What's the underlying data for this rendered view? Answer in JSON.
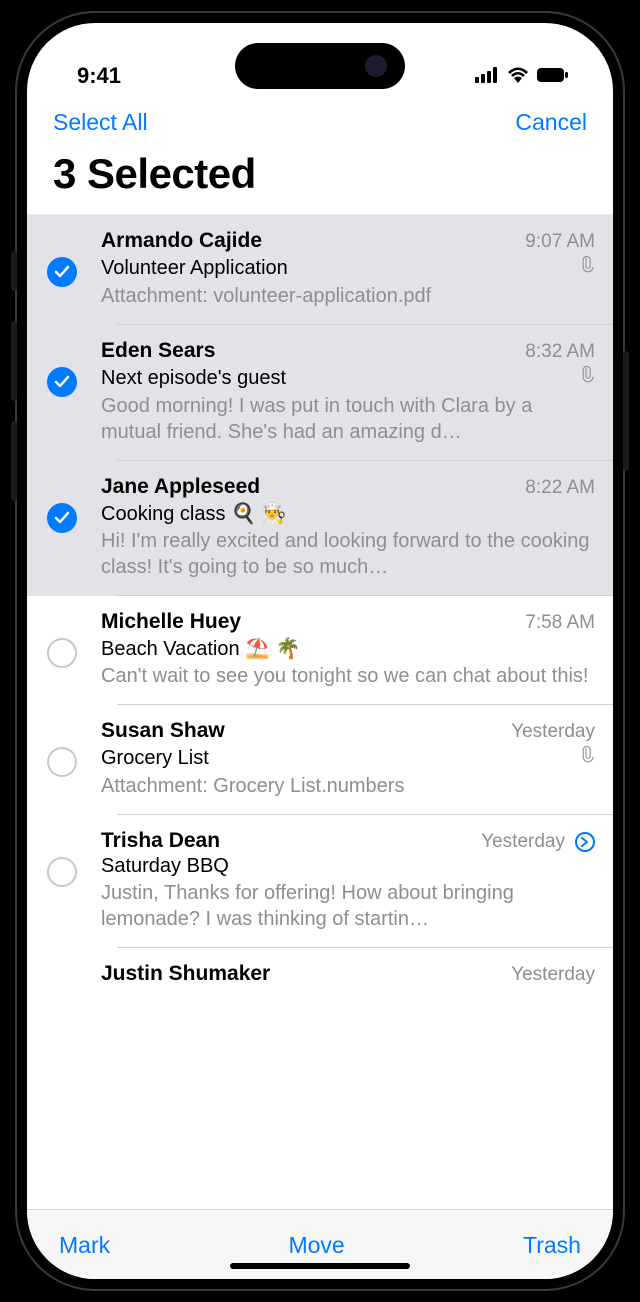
{
  "status": {
    "time": "9:41"
  },
  "nav": {
    "selectAll": "Select All",
    "cancel": "Cancel"
  },
  "title": "3 Selected",
  "toolbar": {
    "mark": "Mark",
    "move": "Move",
    "trash": "Trash"
  },
  "emails": [
    {
      "sender": "Armando Cajide",
      "time": "9:07 AM",
      "subject": "Volunteer Application",
      "preview": "Attachment: volunteer-application.pdf",
      "selected": true,
      "attachment": true,
      "chevron": false
    },
    {
      "sender": "Eden Sears",
      "time": "8:32 AM",
      "subject": "Next episode's guest",
      "preview": "Good morning! I was put in touch with Clara by a mutual friend. She's had an amazing d…",
      "selected": true,
      "attachment": true,
      "chevron": false
    },
    {
      "sender": "Jane Appleseed",
      "time": "8:22 AM",
      "subject": "Cooking class 🍳 👨‍🍳",
      "preview": "Hi! I'm really excited and looking forward to the cooking class! It's going to be so much…",
      "selected": true,
      "attachment": false,
      "chevron": false
    },
    {
      "sender": "Michelle Huey",
      "time": "7:58 AM",
      "subject": "Beach Vacation ⛱️ 🌴",
      "preview": "Can't wait to see you tonight so we can chat about this!",
      "selected": false,
      "attachment": false,
      "chevron": false
    },
    {
      "sender": "Susan Shaw",
      "time": "Yesterday",
      "subject": "Grocery List",
      "preview": "Attachment: Grocery List.numbers",
      "selected": false,
      "attachment": true,
      "chevron": false
    },
    {
      "sender": "Trisha Dean",
      "time": "Yesterday",
      "subject": "Saturday BBQ",
      "preview": "Justin, Thanks for offering! How about bringing lemonade? I was thinking of startin…",
      "selected": false,
      "attachment": false,
      "chevron": true
    },
    {
      "sender": "Justin Shumaker",
      "time": "Yesterday",
      "subject": "",
      "preview": "",
      "selected": false,
      "attachment": false,
      "chevron": false,
      "partial": true
    }
  ]
}
